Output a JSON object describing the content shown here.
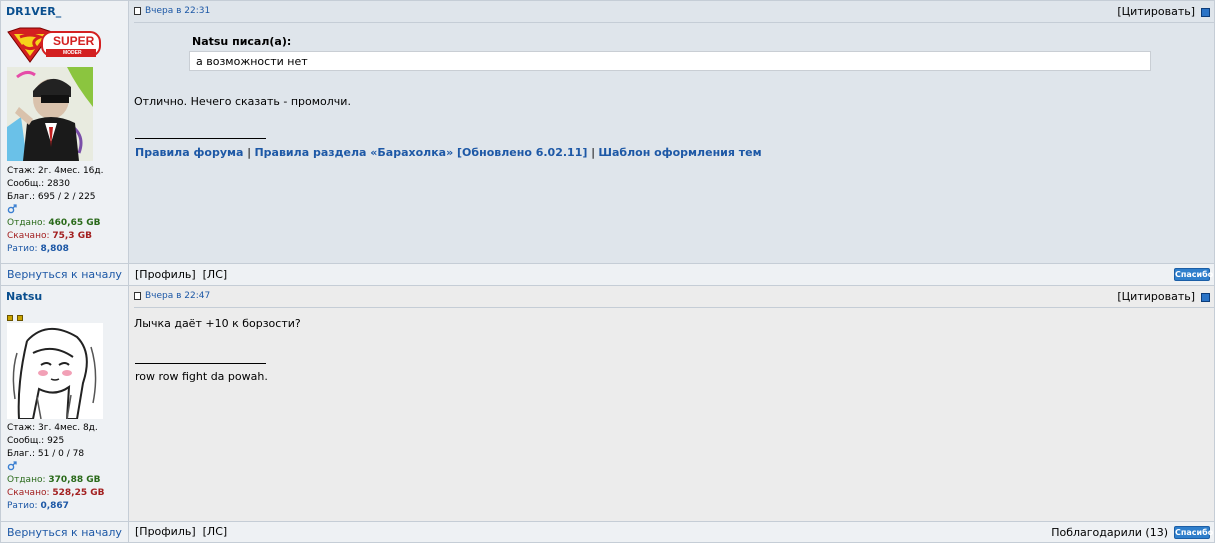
{
  "posts": [
    {
      "nick": "DR1VER_",
      "rank_badge_text": "SUPER",
      "rank_badge_sub": "MODER",
      "stats": {
        "stazh": "Стаж: 2г. 4мес. 16д.",
        "soobsh": "Сообщ.: 2830",
        "blag": "Благ.: 695 / 2 / 225",
        "otdano_label": "Отдано: ",
        "otdano": "460,65 GB",
        "skachano_label": "Скачано: ",
        "skachano": "75,3 GB",
        "ratio_label": "Ратио: ",
        "ratio": "8,808"
      },
      "date": "Вчера в 22:31",
      "quote_btn": "[Цитировать]",
      "quote_author": "Natsu писал(а):",
      "quote_text": "а возможности нет",
      "text": "Отлично. Нечего сказать - промолчи.",
      "sig_links": [
        "Правила форума",
        "Правила раздела «Барахолка» [Обновлено 6.02.11]",
        "Шаблон оформления тем"
      ],
      "back_to_top": "Вернуться к началу",
      "profile": "[Профиль]",
      "pm": "[ЛС]",
      "thanks_btn": "Спасибо"
    },
    {
      "nick": "Natsu",
      "stats": {
        "stazh": "Стаж: 3г. 4мес. 8д.",
        "soobsh": "Сообщ.: 925",
        "blag": "Благ.: 51 / 0 / 78",
        "otdano_label": "Отдано: ",
        "otdano": "370,88 GB",
        "skachano_label": "Скачано: ",
        "skachano": "528,25 GB",
        "ratio_label": "Ратио: ",
        "ratio": "0,867"
      },
      "date": "Вчера в 22:47",
      "quote_btn": "[Цитировать]",
      "text": "Лычка даёт +10 к борзости?",
      "signature": "row row fight da powah.",
      "back_to_top": "Вернуться к началу",
      "profile": "[Профиль]",
      "pm": "[ЛС]",
      "thanked": "Поблагодарили (13)",
      "thanks_btn": "Спасибо"
    }
  ],
  "colors": {
    "link": "#1d58a6",
    "post1_bg": "#dfe5eb",
    "post2_bg": "#ececec",
    "border": "#c5cdd6"
  }
}
